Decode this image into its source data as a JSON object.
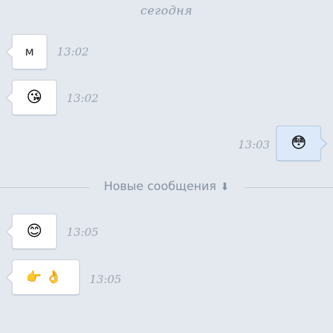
{
  "date_header": "сегодня",
  "messages": [
    {
      "direction": "incoming",
      "content": "м",
      "time": "13:02"
    },
    {
      "direction": "incoming",
      "content": "😘",
      "time": "13:02"
    },
    {
      "direction": "outgoing",
      "content": "😳",
      "time": "13:03"
    },
    {
      "direction": "incoming",
      "content": "😊",
      "time": "13:05"
    },
    {
      "direction": "incoming",
      "content": "👉👌",
      "time": "13:05"
    }
  ],
  "new_messages_divider": {
    "label": "Новые сообщения",
    "icon": "arrow-down-icon",
    "arrow": "⬇"
  },
  "colors": {
    "background": "#e4e9ef",
    "incoming_bubble": "#ffffff",
    "outgoing_bubble": "#dbe9f8",
    "meta_text": "#9aa5b3"
  }
}
